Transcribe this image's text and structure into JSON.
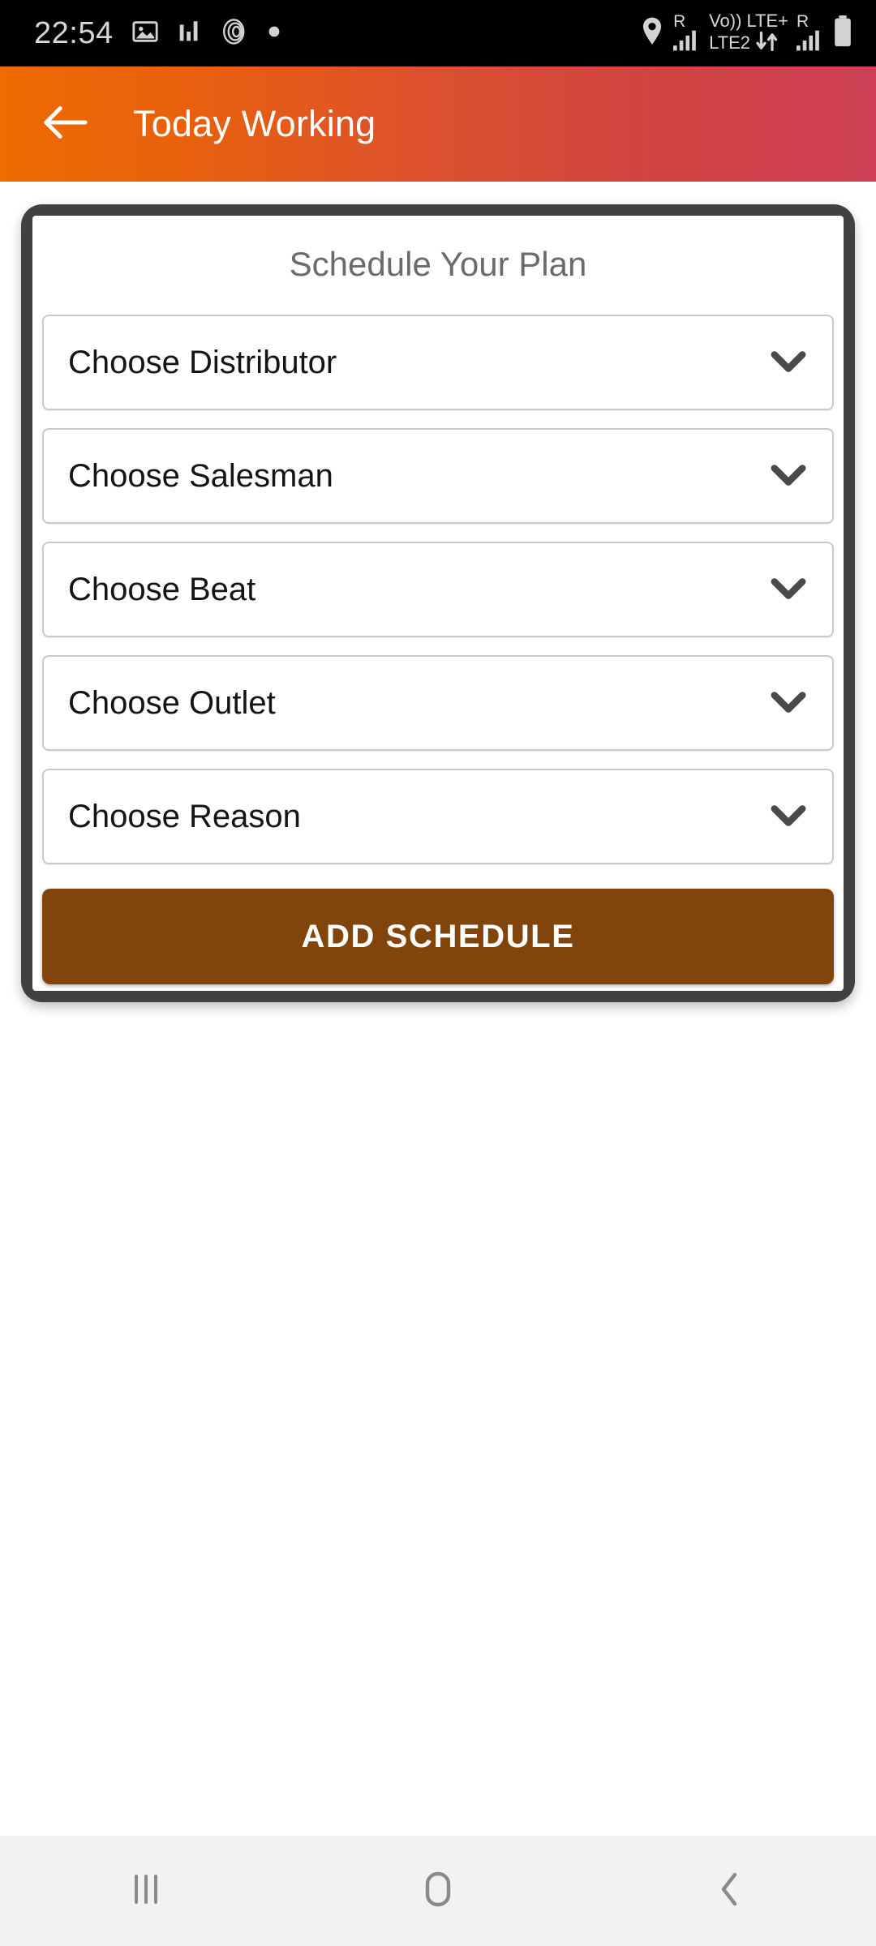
{
  "status_bar": {
    "clock": "22:54",
    "left_icons": [
      "image-icon",
      "bar-chart-icon",
      "spiral-disc-icon",
      "dot-icon"
    ],
    "sim1_roaming": "R",
    "volte_label": "Vo))",
    "network_type_label": "LTE2",
    "lte_plus_label": "LTE+",
    "sim2_roaming": "R",
    "right_icons": [
      "location-pin-icon",
      "signal-bars-icon",
      "data-transfer-icon",
      "signal-bars-icon",
      "battery-icon"
    ]
  },
  "app_bar": {
    "title": "Today Working",
    "back_icon": "arrow-left-icon",
    "gradient_start": "#ED6B00",
    "gradient_end": "#CE3F55"
  },
  "card": {
    "title": "Schedule Your Plan",
    "border_color": "#414141",
    "fields": [
      {
        "label": "Choose Distributor",
        "name": "distributor",
        "icon": "chevron-down-icon"
      },
      {
        "label": "Choose Salesman",
        "name": "salesman",
        "icon": "chevron-down-icon"
      },
      {
        "label": "Choose Beat",
        "name": "beat",
        "icon": "chevron-down-icon"
      },
      {
        "label": "Choose Outlet",
        "name": "outlet",
        "icon": "chevron-down-icon"
      },
      {
        "label": "Choose Reason",
        "name": "reason",
        "icon": "chevron-down-icon"
      }
    ],
    "submit_label": "ADD SCHEDULE",
    "submit_color": "#81440A"
  },
  "nav_bar": {
    "recents_icon": "recents-icon",
    "home_icon": "home-icon",
    "back_icon": "back-chevron-icon"
  }
}
